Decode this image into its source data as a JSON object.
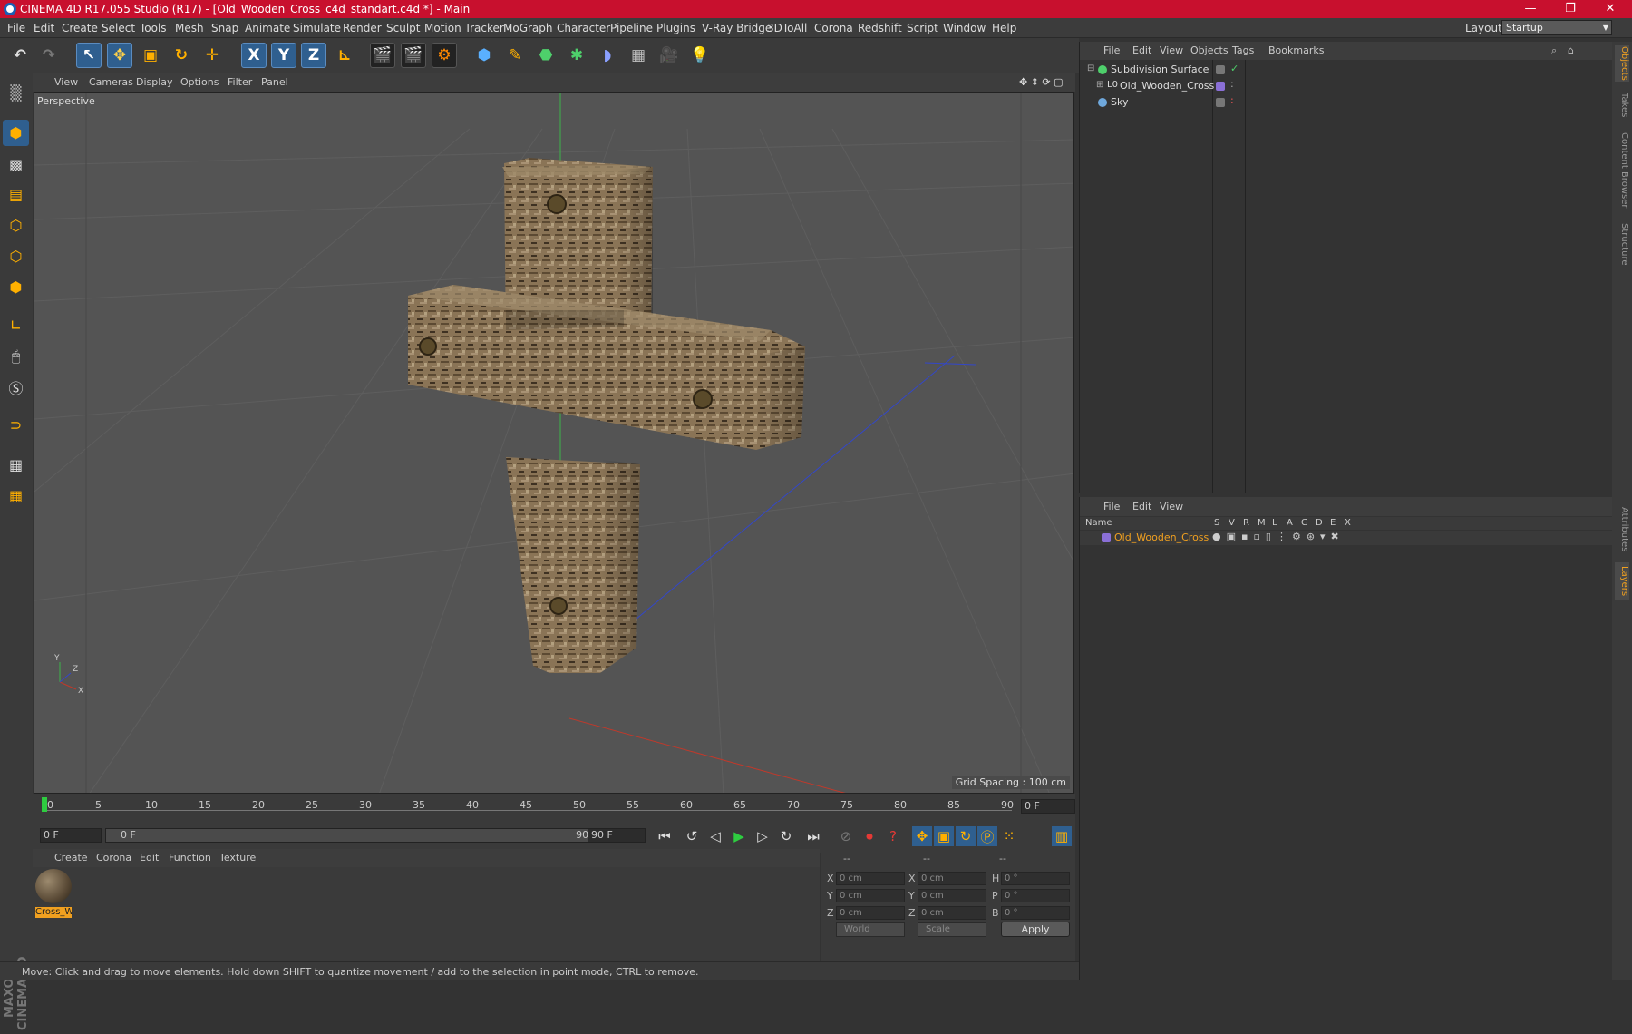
{
  "titlebar": {
    "title": "CINEMA 4D R17.055 Studio (R17) - [Old_Wooden_Cross_c4d_standart.c4d *] - Main",
    "minimize": "—",
    "restore": "❐",
    "close": "✕"
  },
  "menubar": {
    "items": [
      "File",
      "Edit",
      "Create",
      "Select",
      "Tools",
      "Mesh",
      "Snap",
      "Animate",
      "Simulate",
      "Render",
      "Sculpt",
      "Motion Tracker",
      "MoGraph",
      "Character",
      "Pipeline",
      "Plugins",
      "V-Ray Bridge",
      "3DToAll",
      "Corona",
      "Redshift",
      "Script",
      "Window",
      "Help"
    ],
    "layout_label": "Layout:",
    "layout_value": "Startup"
  },
  "toolbar": {
    "axis_x": "X",
    "axis_y": "Y",
    "axis_z": "Z"
  },
  "viewport": {
    "menu": [
      "View",
      "Cameras",
      "Display",
      "Options",
      "Filter",
      "Panel"
    ],
    "label": "Perspective",
    "grid_spacing": "Grid Spacing : 100 cm"
  },
  "timeline": {
    "ticks": [
      "0",
      "5",
      "10",
      "15",
      "20",
      "25",
      "30",
      "35",
      "40",
      "45",
      "50",
      "55",
      "60",
      "65",
      "70",
      "75",
      "80",
      "85",
      "90"
    ],
    "current_frame": "0 F"
  },
  "playbar": {
    "start": "0 F",
    "range_start": "0 F",
    "range_end": "90 F",
    "end": "90 F"
  },
  "materials": {
    "menu": [
      "Create",
      "Corona",
      "Edit",
      "Function",
      "Texture"
    ],
    "items": [
      {
        "name": "Cross_W"
      }
    ]
  },
  "coords": {
    "headers": [
      "--",
      "--",
      "--"
    ],
    "rows": [
      {
        "a": "X",
        "av": "0 cm",
        "b": "X",
        "bv": "0 cm",
        "c": "H",
        "cv": "0 °"
      },
      {
        "a": "Y",
        "av": "0 cm",
        "b": "Y",
        "bv": "0 cm",
        "c": "P",
        "cv": "0 °"
      },
      {
        "a": "Z",
        "av": "0 cm",
        "b": "Z",
        "bv": "0 cm",
        "c": "B",
        "cv": "0 °"
      }
    ],
    "mode1": "World",
    "mode2": "Scale",
    "apply": "Apply"
  },
  "status": {
    "text": "Move: Click and drag to move elements. Hold down SHIFT to quantize movement / add to the selection in point mode, CTRL to remove.",
    "brand": "MAXON CINEMA 4D"
  },
  "objects": {
    "menu": [
      "File",
      "Edit",
      "View",
      "Objects",
      "Tags",
      "Bookmarks"
    ],
    "items": [
      {
        "name": "Subdivision Surface"
      },
      {
        "name": "Old_Wooden_Cross"
      },
      {
        "name": "Sky"
      }
    ]
  },
  "layers": {
    "menu": [
      "File",
      "Edit",
      "View"
    ],
    "columns": [
      "Name",
      "S",
      "V",
      "R",
      "M",
      "L",
      "A",
      "G",
      "D",
      "E",
      "X"
    ],
    "items": [
      {
        "name": "Old_Wooden_Cross"
      }
    ]
  },
  "right_tabs": [
    "Objects",
    "Takes",
    "Content Browser",
    "Structure",
    "Attributes",
    "Layers"
  ],
  "colors": {
    "title_red": "#c8102e",
    "accent_orange": "#f0a020",
    "layer_purple": "#8a6fd6"
  }
}
